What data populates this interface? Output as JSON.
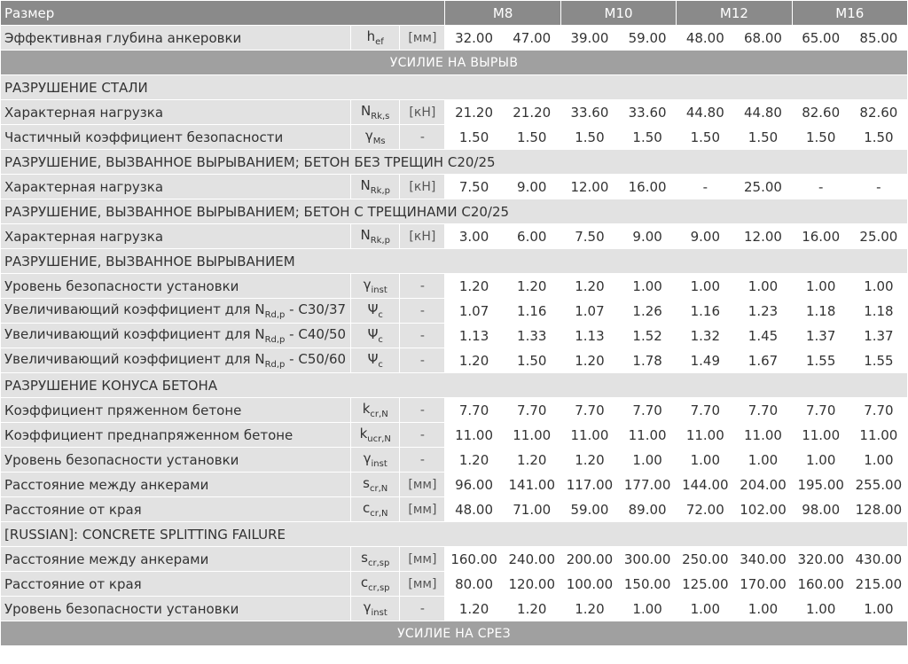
{
  "header": {
    "label": "Размер",
    "sizes": [
      "M8",
      "M10",
      "M12",
      "M16"
    ]
  },
  "rows": [
    {
      "type": "data",
      "label": "Эффективная глубина анкеровки",
      "sym": "h",
      "sub": "ef",
      "unit": "[мм]",
      "values": [
        "32.00",
        "47.00",
        "39.00",
        "59.00",
        "48.00",
        "68.00",
        "65.00",
        "85.00"
      ]
    },
    {
      "type": "band",
      "label": "УСИЛИЕ НА ВЫРЫВ"
    },
    {
      "type": "section",
      "label": "РАЗРУШЕНИЕ СТАЛИ"
    },
    {
      "type": "data",
      "label": "Характерная нагрузка",
      "sym": "N",
      "sub": "Rk,s",
      "unit": "[кН]",
      "values": [
        "21.20",
        "21.20",
        "33.60",
        "33.60",
        "44.80",
        "44.80",
        "82.60",
        "82.60"
      ]
    },
    {
      "type": "data",
      "label": "Частичный коэффициент безопасности",
      "sym": "γ",
      "sub": "Ms",
      "unit": "-",
      "values": [
        "1.50",
        "1.50",
        "1.50",
        "1.50",
        "1.50",
        "1.50",
        "1.50",
        "1.50"
      ]
    },
    {
      "type": "section",
      "label": "РАЗРУШЕНИЕ, ВЫЗВАННОЕ ВЫРЫВАНИЕМ; БЕТОН БЕЗ ТРЕЩИН C20/25"
    },
    {
      "type": "data",
      "label": "Характерная нагрузка",
      "sym": "N",
      "sub": "Rk,p",
      "unit": "[кН]",
      "values": [
        "7.50",
        "9.00",
        "12.00",
        "16.00",
        "-",
        "25.00",
        "-",
        "-"
      ]
    },
    {
      "type": "section",
      "label": "РАЗРУШЕНИЕ, ВЫЗВАННОЕ ВЫРЫВАНИЕМ; БЕТОН С ТРЕЩИНАМИ C20/25"
    },
    {
      "type": "data",
      "label": "Характерная нагрузка",
      "sym": "N",
      "sub": "Rk,p",
      "unit": "[кН]",
      "values": [
        "3.00",
        "6.00",
        "7.50",
        "9.00",
        "9.00",
        "12.00",
        "16.00",
        "25.00"
      ]
    },
    {
      "type": "section",
      "label": "РАЗРУШЕНИЕ, ВЫЗВАННОЕ ВЫРЫВАНИЕМ"
    },
    {
      "type": "data",
      "label": "Уровень безопасности установки",
      "sym": "γ",
      "sub": "inst",
      "unit": "-",
      "values": [
        "1.20",
        "1.20",
        "1.20",
        "1.00",
        "1.00",
        "1.00",
        "1.00",
        "1.00"
      ]
    },
    {
      "type": "data",
      "label": "Увеличивающий коэффициент для N",
      "labelSub": "Rd,p",
      "labelTail": " - C30/37",
      "sym": "Ψ",
      "sub": "c",
      "unit": "-",
      "values": [
        "1.07",
        "1.16",
        "1.07",
        "1.26",
        "1.16",
        "1.23",
        "1.18",
        "1.18"
      ]
    },
    {
      "type": "data",
      "label": "Увеличивающий коэффициент для N",
      "labelSub": "Rd,p",
      "labelTail": " - C40/50",
      "sym": "Ψ",
      "sub": "c",
      "unit": "-",
      "values": [
        "1.13",
        "1.33",
        "1.13",
        "1.52",
        "1.32",
        "1.45",
        "1.37",
        "1.37"
      ]
    },
    {
      "type": "data",
      "label": "Увеличивающий коэффициент для N",
      "labelSub": "Rd,p",
      "labelTail": " - C50/60",
      "sym": "Ψ",
      "sub": "c",
      "unit": "-",
      "values": [
        "1.20",
        "1.50",
        "1.20",
        "1.78",
        "1.49",
        "1.67",
        "1.55",
        "1.55"
      ]
    },
    {
      "type": "section",
      "label": "РАЗРУШЕНИЕ КОНУСА БЕТОНА"
    },
    {
      "type": "data",
      "label": "Коэффициент пряженном бетоне",
      "sym": "k",
      "sub": "cr,N",
      "unit": "-",
      "values": [
        "7.70",
        "7.70",
        "7.70",
        "7.70",
        "7.70",
        "7.70",
        "7.70",
        "7.70"
      ]
    },
    {
      "type": "data",
      "label": "Коэффициент преднапряженном бетоне",
      "sym": "k",
      "sub": "ucr,N",
      "unit": "-",
      "values": [
        "11.00",
        "11.00",
        "11.00",
        "11.00",
        "11.00",
        "11.00",
        "11.00",
        "11.00"
      ]
    },
    {
      "type": "data",
      "label": "Уровень безопасности установки",
      "sym": "γ",
      "sub": "inst",
      "unit": "-",
      "values": [
        "1.20",
        "1.20",
        "1.20",
        "1.00",
        "1.00",
        "1.00",
        "1.00",
        "1.00"
      ]
    },
    {
      "type": "data",
      "label": "Расстояние между анкерами",
      "sym": "s",
      "sub": "cr,N",
      "unit": "[мм]",
      "values": [
        "96.00",
        "141.00",
        "117.00",
        "177.00",
        "144.00",
        "204.00",
        "195.00",
        "255.00"
      ]
    },
    {
      "type": "data",
      "label": "Расстояние от края",
      "sym": "c",
      "sub": "cr,N",
      "unit": "[мм]",
      "values": [
        "48.00",
        "71.00",
        "59.00",
        "89.00",
        "72.00",
        "102.00",
        "98.00",
        "128.00"
      ]
    },
    {
      "type": "section",
      "label": "[RUSSIAN]: CONCRETE SPLITTING FAILURE"
    },
    {
      "type": "data",
      "label": "Расстояние между анкерами",
      "sym": "s",
      "sub": "cr,sp",
      "unit": "[мм]",
      "values": [
        "160.00",
        "240.00",
        "200.00",
        "300.00",
        "250.00",
        "340.00",
        "320.00",
        "430.00"
      ]
    },
    {
      "type": "data",
      "label": "Расстояние от края",
      "sym": "c",
      "sub": "cr,sp",
      "unit": "[мм]",
      "values": [
        "80.00",
        "120.00",
        "100.00",
        "150.00",
        "125.00",
        "170.00",
        "160.00",
        "215.00"
      ]
    },
    {
      "type": "data",
      "label": "Уровень безопасности установки",
      "sym": "γ",
      "sub": "inst",
      "unit": "-",
      "values": [
        "1.20",
        "1.20",
        "1.20",
        "1.00",
        "1.00",
        "1.00",
        "1.00",
        "1.00"
      ]
    },
    {
      "type": "band",
      "label": "УСИЛИЕ НА СРЕЗ"
    }
  ]
}
